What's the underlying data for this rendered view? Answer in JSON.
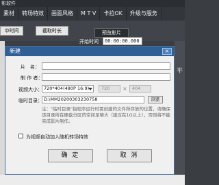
{
  "app": {
    "title": "影软件",
    "menu": [
      "素材",
      "转场特效",
      "画面风格",
      "M T V",
      "卡拉OK",
      "升级与服务"
    ],
    "toolbar": {
      "left_btn": "中时间",
      "mid_btn": "截取时长",
      "preview_btn": "预览影片",
      "start_time_label": "开始时间",
      "start_time_value": "00:00:00.000"
    },
    "watermark": "平"
  },
  "dialog": {
    "title": "新建",
    "close": "×",
    "labels": {
      "film_name": "片　名：",
      "producer": "制 作 者：",
      "video_size": "视频大小：",
      "temp_dir": "临时目录："
    },
    "values": {
      "film_name": "",
      "producer": "",
      "video_size": "720*404(480P 16:9)",
      "width": "720",
      "times_sign": "×",
      "height": "404",
      "temp_dir": "D:\\MM20200303230758"
    },
    "browse_button": "浏览",
    "hint": "注：\"临时目录\"指程序运行时需创建的文件所存放的位置，请确保该目录所在硬盘分区的空间足够大（建议在1G以上），否则将不能完成影片制作。",
    "checkbox_label": "为视频自动加入随机转场特效",
    "checkbox_checked": false,
    "ok_button": "确 定",
    "cancel_button": "取 消"
  }
}
